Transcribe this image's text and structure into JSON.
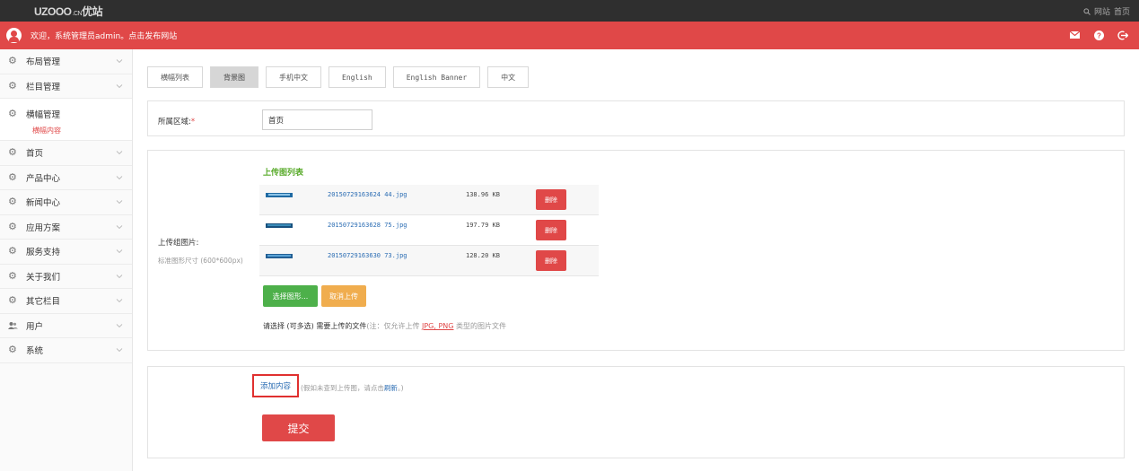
{
  "header": {
    "logo_text": "UZOOO",
    "logo_cn": ".CN",
    "logo_brand": "优站",
    "links": [
      "网站",
      "首页"
    ]
  },
  "userbar": {
    "welcome": "欢迎，系统管理员admin。点击发布网站",
    "icons": [
      "mail-icon",
      "help-icon",
      "logout-icon"
    ]
  },
  "sidebar": {
    "items": [
      {
        "label": "布局管理"
      },
      {
        "label": "栏目管理"
      },
      {
        "label": "横幅管理",
        "sub": "横幅内容"
      },
      {
        "label": "首页"
      },
      {
        "label": "产品中心"
      },
      {
        "label": "新闻中心"
      },
      {
        "label": "应用方案"
      },
      {
        "label": "服务支持"
      },
      {
        "label": "关于我们"
      },
      {
        "label": "其它栏目"
      },
      {
        "label": "用户"
      },
      {
        "label": "系统"
      }
    ]
  },
  "tabs": [
    "横幅列表",
    "背景图",
    "手机中文",
    "English",
    "English Banner",
    "中文"
  ],
  "form": {
    "region_label": "所属区域:",
    "region_required": "*",
    "region_value": "首页",
    "upload_label": "上传组图片:",
    "upload_hint": "标准图形尺寸 (600*600px)",
    "upload_list_title": "上传图列表",
    "files": [
      {
        "name": "20150729163624 44.jpg",
        "size": "138.96 KB",
        "delete": "删除"
      },
      {
        "name": "20150729163628 75.jpg",
        "size": "197.79 KB",
        "delete": "删除"
      },
      {
        "name": "20150729163630 73.jpg",
        "size": "128.20 KB",
        "delete": "删除"
      }
    ],
    "select_button": "选择图形...",
    "cancel_button": "取消上传",
    "note_main": "请选择 (可多选) 需要上传的文件",
    "note_grey": "(注：仅允许上传",
    "note_ext": "JPG, PNG",
    "note_tail": "类型的图片文件",
    "add_content": "添加内容",
    "add_note_a": "(假如未查到上传图，请点击",
    "add_note_refresh": "刷新",
    "add_note_b": "。)",
    "submit": "提交"
  },
  "colors": {
    "accent": "#e04848",
    "green": "#4db04a",
    "orange": "#f0ad4e",
    "link": "#2a6cb3"
  }
}
